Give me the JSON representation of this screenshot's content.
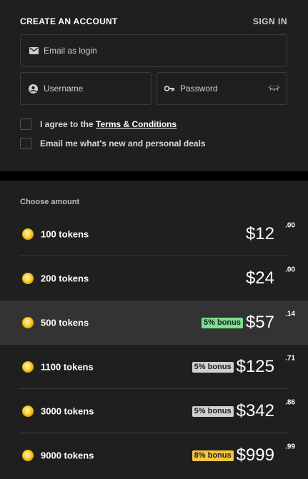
{
  "header": {
    "title": "CREATE AN ACCOUNT",
    "signin_label": "SIGN IN"
  },
  "form": {
    "email_placeholder": "Email as login",
    "username_placeholder": "Username",
    "password_placeholder": "Password"
  },
  "checks": {
    "terms_prefix": "I agree to the ",
    "terms_link": "Terms & Conditions",
    "deals_label": "Email me what's new and personal deals"
  },
  "amount": {
    "heading": "Choose amount",
    "options": [
      {
        "tokens": "100 tokens",
        "bonus": "",
        "price": "$12",
        "cents": ".00",
        "selected": false
      },
      {
        "tokens": "200 tokens",
        "bonus": "",
        "price": "$24",
        "cents": ".00",
        "selected": false
      },
      {
        "tokens": "500 tokens",
        "bonus": "5% bonus",
        "bonus_color": "#7be08f",
        "price": "$57",
        "cents": ".14",
        "selected": true
      },
      {
        "tokens": "1100 tokens",
        "bonus": "5% bonus",
        "bonus_color": "#cfcfcf",
        "price": "$125",
        "cents": ".71",
        "selected": false
      },
      {
        "tokens": "3000 tokens",
        "bonus": "5% bonus",
        "bonus_color": "#cfcfcf",
        "price": "$342",
        "cents": ".86",
        "selected": false
      },
      {
        "tokens": "9000 tokens",
        "bonus": "8% bonus",
        "bonus_color": "#f5c542",
        "price": "$999",
        "cents": ".99",
        "selected": false
      }
    ]
  },
  "icons": {
    "email": "envelope-icon",
    "username": "user-icon",
    "password": "key-icon",
    "show_password": "eye-closed-icon",
    "coin": "coin-icon"
  }
}
